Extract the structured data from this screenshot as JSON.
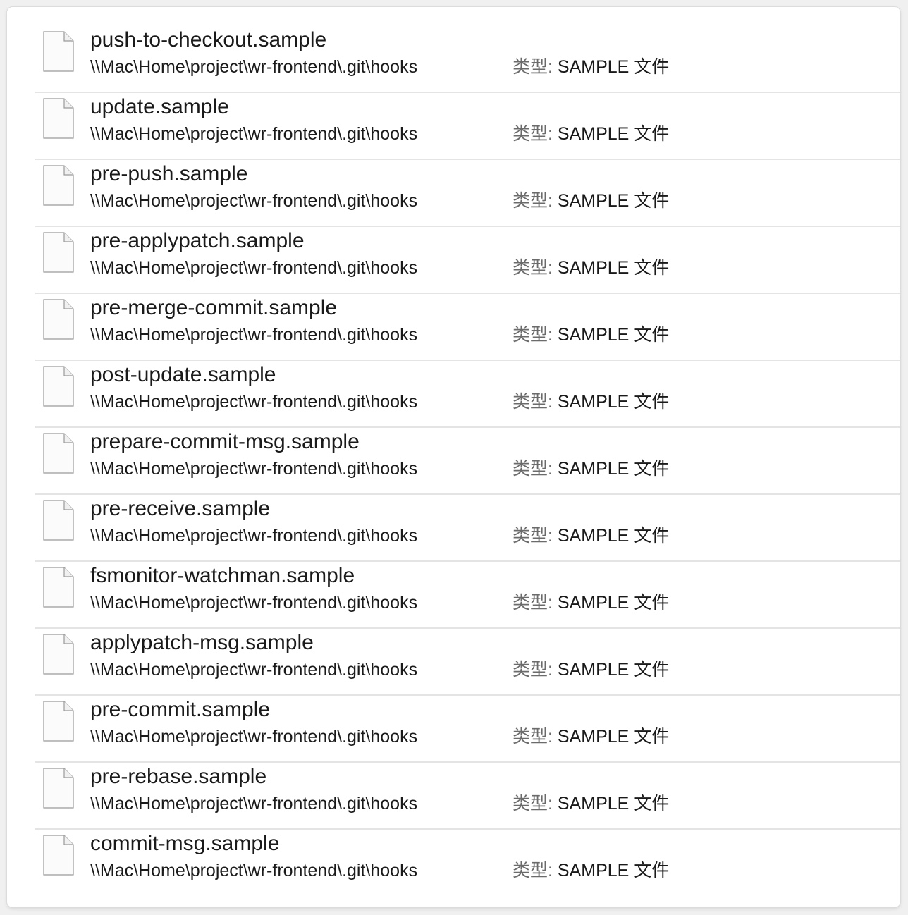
{
  "search_results": {
    "type_label": "类型:",
    "items": [
      {
        "name": "push-to-checkout.sample",
        "path": "\\\\Mac\\Home\\project\\wr-frontend\\.git\\hooks",
        "type": "SAMPLE 文件",
        "icon": "file-icon"
      },
      {
        "name": "update.sample",
        "path": "\\\\Mac\\Home\\project\\wr-frontend\\.git\\hooks",
        "type": "SAMPLE 文件",
        "icon": "file-icon"
      },
      {
        "name": "pre-push.sample",
        "path": "\\\\Mac\\Home\\project\\wr-frontend\\.git\\hooks",
        "type": "SAMPLE 文件",
        "icon": "file-icon"
      },
      {
        "name": "pre-applypatch.sample",
        "path": "\\\\Mac\\Home\\project\\wr-frontend\\.git\\hooks",
        "type": "SAMPLE 文件",
        "icon": "file-icon"
      },
      {
        "name": "pre-merge-commit.sample",
        "path": "\\\\Mac\\Home\\project\\wr-frontend\\.git\\hooks",
        "type": "SAMPLE 文件",
        "icon": "file-icon"
      },
      {
        "name": "post-update.sample",
        "path": "\\\\Mac\\Home\\project\\wr-frontend\\.git\\hooks",
        "type": "SAMPLE 文件",
        "icon": "file-icon"
      },
      {
        "name": "prepare-commit-msg.sample",
        "path": "\\\\Mac\\Home\\project\\wr-frontend\\.git\\hooks",
        "type": "SAMPLE 文件",
        "icon": "file-icon"
      },
      {
        "name": "pre-receive.sample",
        "path": "\\\\Mac\\Home\\project\\wr-frontend\\.git\\hooks",
        "type": "SAMPLE 文件",
        "icon": "file-icon"
      },
      {
        "name": "fsmonitor-watchman.sample",
        "path": "\\\\Mac\\Home\\project\\wr-frontend\\.git\\hooks",
        "type": "SAMPLE 文件",
        "icon": "file-icon"
      },
      {
        "name": "applypatch-msg.sample",
        "path": "\\\\Mac\\Home\\project\\wr-frontend\\.git\\hooks",
        "type": "SAMPLE 文件",
        "icon": "file-icon"
      },
      {
        "name": "pre-commit.sample",
        "path": "\\\\Mac\\Home\\project\\wr-frontend\\.git\\hooks",
        "type": "SAMPLE 文件",
        "icon": "file-icon"
      },
      {
        "name": "pre-rebase.sample",
        "path": "\\\\Mac\\Home\\project\\wr-frontend\\.git\\hooks",
        "type": "SAMPLE 文件",
        "icon": "file-icon"
      },
      {
        "name": "commit-msg.sample",
        "path": "\\\\Mac\\Home\\project\\wr-frontend\\.git\\hooks",
        "type": "SAMPLE 文件",
        "icon": "file-icon"
      }
    ]
  }
}
